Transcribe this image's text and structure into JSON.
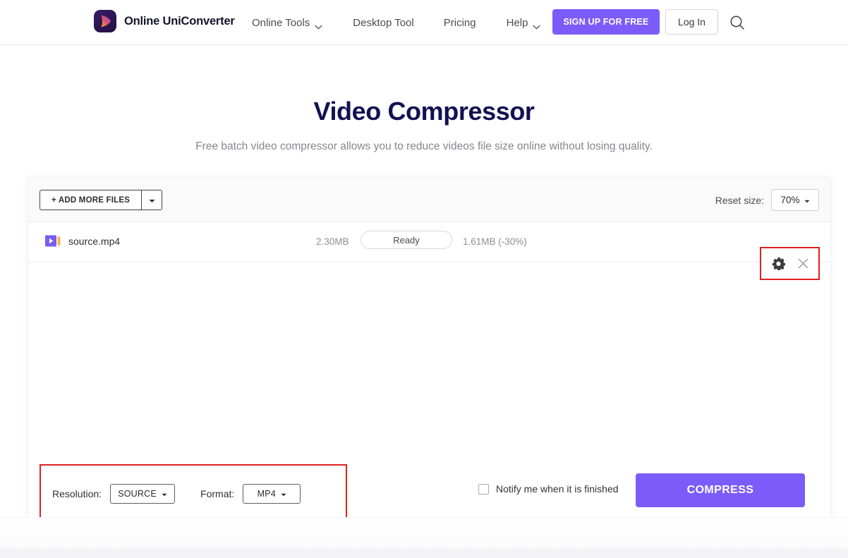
{
  "header": {
    "brand": "Online UniConverter",
    "logo_icon": "play-logo-icon",
    "nav": [
      {
        "label": "Online Tools",
        "has_caret": true
      },
      {
        "label": "Desktop Tool",
        "has_caret": false
      },
      {
        "label": "Pricing",
        "has_caret": false
      },
      {
        "label": "Help",
        "has_caret": true
      }
    ],
    "signup_label": "SIGN UP FOR FREE",
    "login_label": "Log In",
    "search_icon": "search-icon",
    "accent_color": "#7b5cfa"
  },
  "hero": {
    "title": "Video Compressor",
    "subtitle": "Free batch video compressor allows you to reduce videos file size online without losing quality.",
    "title_color": "#111152"
  },
  "toolbar": {
    "add_files_label": "+ ADD MORE FILES",
    "add_files_caret_icon": "caret-down-icon",
    "reset_size_label": "Reset size:",
    "reset_size_value": "70%",
    "reset_size_caret_icon": "caret-down-icon"
  },
  "file_row": {
    "icon": "video-file-icon",
    "name": "source.mp4",
    "source_size": "2.30MB",
    "status": "Ready",
    "output_size": "1.61MB (-30%)",
    "settings_icon": "gear-icon",
    "remove_icon": "close-icon",
    "highlight_color": "#e02020"
  },
  "bottom_bar": {
    "resolution_label": "Resolution:",
    "resolution_value": "SOURCE",
    "resolution_caret_icon": "caret-down-icon",
    "format_label": "Format:",
    "format_value": "MP4",
    "format_caret_icon": "caret-down-icon",
    "notify_label": "Notify me when it is finished",
    "notify_checked": false,
    "compress_label": "COMPRESS",
    "highlight_color": "#e02020"
  }
}
